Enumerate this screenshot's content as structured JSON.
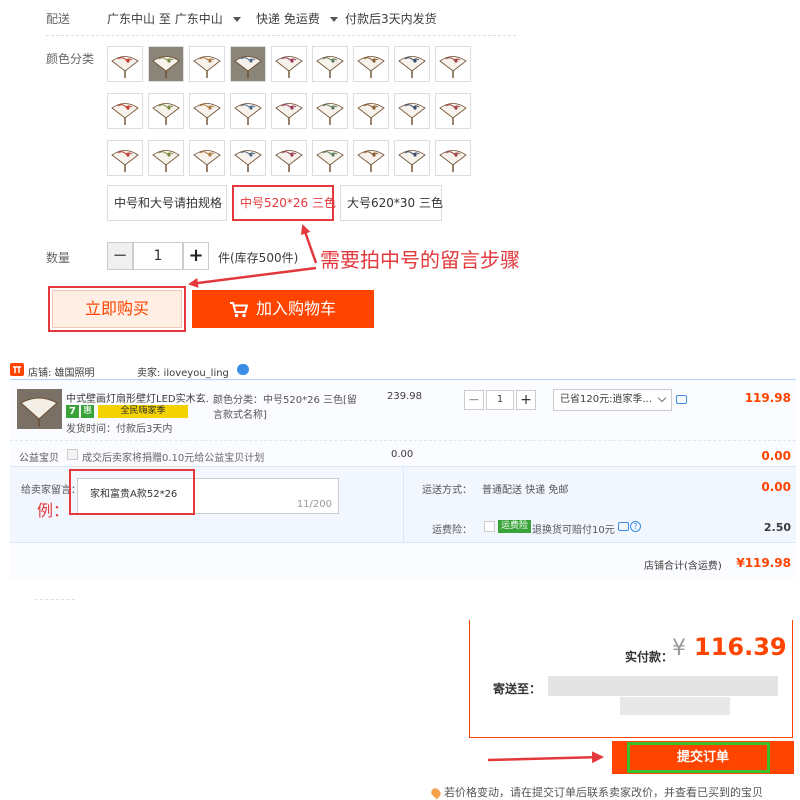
{
  "delivery": {
    "label": "配送",
    "from": "广东中山",
    "to_word": "至",
    "to": "广东中山",
    "shipping": "快递 免运费",
    "dispatch": "付款后3天内发货"
  },
  "color": {
    "label": "颜色分类",
    "thumbnail_count": 27,
    "thumbnail_icon": "folding-fan-icon"
  },
  "sizes": {
    "options": [
      "中号和大号请拍规格",
      "中号520*26 三色",
      "大号620*30 三色"
    ],
    "selected_index": 1
  },
  "quantity": {
    "label": "数量",
    "minus": "−",
    "value": "1",
    "plus": "+",
    "stock": "件(库存500件)"
  },
  "buttons": {
    "buy_now": "立即购买",
    "add_cart": "加入购物车",
    "cart_icon": "shopping-cart-icon"
  },
  "annotations": {
    "medium_hint": "需要拍中号的留言步骤",
    "example": "例："
  },
  "order": {
    "shop_icon": "tmall-icon",
    "shop_label": "店铺: 雄国照明",
    "seller_label": "卖家: iloveyou_ling",
    "chat_icon": "chat-bubble-icon",
    "item": {
      "title": "中式壁画灯扇形壁灯LED实木玄...",
      "badge_seven": "7",
      "badge_hui": "惠",
      "badge_event": "全民嗨家季",
      "ship_time": "发货时间：付款后3天内",
      "sku_line1": "颜色分类：中号520*26 三色[留",
      "sku_line2": "言款式名称]",
      "unit_price": "239.98",
      "qty": "1",
      "minus": "−",
      "plus": "+",
      "promo": "已省120元:逍家季...",
      "subtotal": "119.98"
    },
    "charity": {
      "label": "公益宝贝",
      "text": "成交后卖家将捐赠0.10元给公益宝贝计划",
      "mid_amount": "0.00",
      "amount": "0.00"
    },
    "message": {
      "label": "给卖家留言：",
      "value": "家和富贵A款52*26",
      "counter": "11/200"
    },
    "shipping": {
      "label": "运送方式：",
      "value": "普通配送 快递 免邮",
      "amount": "0.00"
    },
    "insurance": {
      "label": "运费险：",
      "badge": "运费险",
      "text": "退换货可赔付10元",
      "amount": "2.50"
    },
    "total": {
      "label": "店铺合计(含运费)",
      "value": "¥119.98"
    }
  },
  "pay": {
    "paid_label": "实付款：",
    "currency": "¥",
    "paid_value": "116.39",
    "ship_to_label": "寄送至：",
    "submit": "提交订单",
    "notice": "若价格变动，请在提交订单后联系卖家改价，并查看已买到的宝贝",
    "notice_icon": "location-pin-icon"
  },
  "colors": {
    "accent": "#ff4400",
    "annotation_red": "#e4393c",
    "highlight_green": "#3bbf2a",
    "order_border": "#b2d1ff"
  }
}
